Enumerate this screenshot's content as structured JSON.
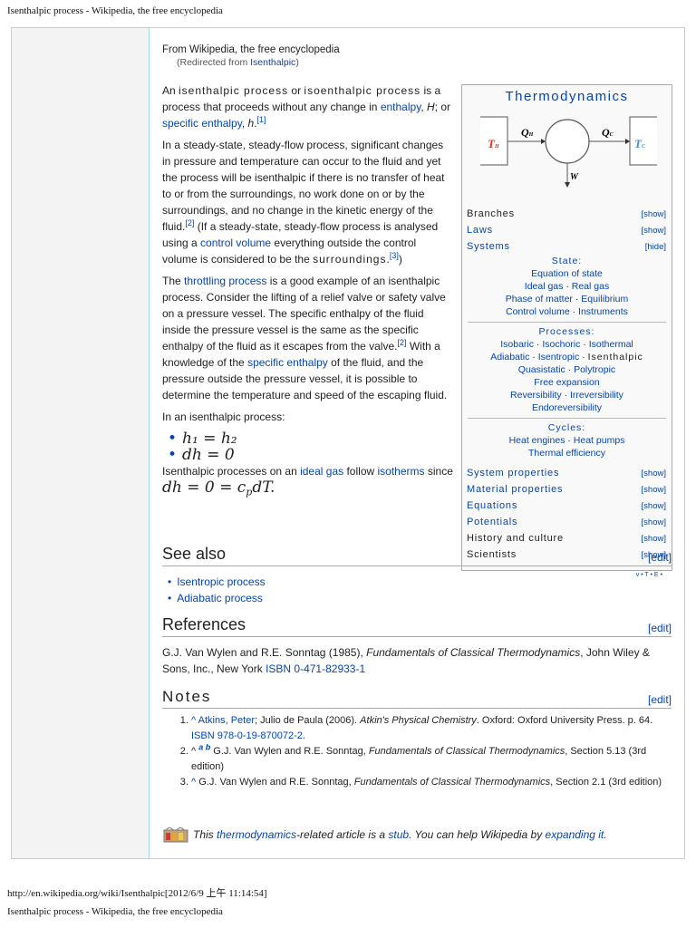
{
  "print_header": "Isenthalpic process - Wikipedia, the free encyclopedia",
  "print_footer_url": "http://en.wikipedia.org/wiki/Isenthalpic[2012/6/9 上午 11:14:54]",
  "print_footer_title": "Isenthalpic process - Wikipedia, the free encyclopedia",
  "from": "From Wikipedia, the free encyclopedia",
  "redirect": {
    "prefix": "(Redirected from ",
    "link": "Isenthalpic",
    "suffix": ")"
  },
  "paragraphs": [
    [
      [
        "t",
        "An "
      ],
      [
        "sp",
        "isenthalpic process"
      ],
      [
        "t",
        " or "
      ],
      [
        "sp",
        "isoenthalpic process"
      ],
      [
        "t",
        " is a process that proceeds without any change in "
      ],
      [
        "l",
        "enthalpy"
      ],
      [
        "t",
        ", "
      ],
      [
        "i",
        "H"
      ],
      [
        "t",
        "; or "
      ],
      [
        "l",
        "specific enthalpy"
      ],
      [
        "t",
        ", "
      ],
      [
        "i",
        "h"
      ],
      [
        "t",
        "."
      ],
      [
        "s",
        "[1]"
      ]
    ],
    [
      [
        "t",
        "In a steady-state, steady-flow process, significant changes in pressure and temperature can occur to the fluid and yet the process will be isenthalpic if there is no transfer of heat to or from the surroundings, no work done on or by the surroundings, and no change in the kinetic energy of the fluid."
      ],
      [
        "s",
        "[2]"
      ],
      [
        "t",
        " (If a steady-state, steady-flow process is analysed using a "
      ],
      [
        "l",
        "control volume"
      ],
      [
        "t",
        " everything outside the control volume is considered to be the "
      ],
      [
        "sp",
        "surroundings"
      ],
      [
        "t",
        "."
      ],
      [
        "s",
        "[3]"
      ],
      [
        "t",
        ")"
      ]
    ],
    [
      [
        "t",
        "The "
      ],
      [
        "l",
        "throttling process"
      ],
      [
        "t",
        " is a good example of an isenthalpic process. Consider the lifting of a relief valve or safety valve on a pressure vessel. The specific enthalpy of the fluid inside the pressure vessel is the same as the specific enthalpy of the fluid as it escapes from the valve."
      ],
      [
        "s",
        "[2]"
      ],
      [
        "t",
        " With a knowledge of the "
      ],
      [
        "l",
        "specific enthalpy"
      ],
      [
        "t",
        " of the fluid, and the pressure outside the pressure vessel, it is possible to determine the temperature and speed of the escaping fluid."
      ]
    ],
    [
      [
        "t",
        "In an isenthalpic process:"
      ]
    ]
  ],
  "equations": [
    "h₁ = h₂",
    "dh = 0"
  ],
  "after_eq": [
    [
      "t",
      "Isenthalpic processes on an "
    ],
    [
      "l",
      "ideal gas"
    ],
    [
      "t",
      " follow "
    ],
    [
      "l",
      "isotherms"
    ],
    [
      "t",
      " since "
    ],
    [
      "m",
      "dh = 0 = c"
    ],
    [
      "ms",
      "p"
    ],
    [
      "m",
      "dT."
    ]
  ],
  "infobox": {
    "title": "Thermodynamics",
    "diagram": {
      "hot": "T",
      "hot_sub": "H",
      "cold": "T",
      "cold_sub": "C",
      "qh": "Q",
      "qh_sub": "H",
      "qc": "Q",
      "qc_sub": "C",
      "w": "W",
      "hot_color": "#e0301e",
      "cold_color": "#3c8ee0"
    },
    "rows_top": [
      {
        "label": "Branches",
        "link": false,
        "toggle": "[show]"
      },
      {
        "label": "Laws",
        "link": true,
        "toggle": "[show]"
      },
      {
        "label": "Systems",
        "link": true,
        "toggle": "[hide]"
      }
    ],
    "groups": [
      {
        "heading": "State:",
        "lines": [
          [
            "Equation of state"
          ],
          [
            "Ideal gas",
            "Real gas"
          ],
          [
            "Phase of matter",
            "Equilibrium"
          ],
          [
            "Control volume",
            "Instruments"
          ]
        ]
      },
      {
        "heading": "Processes:",
        "lines": [
          [
            "Isobaric",
            "Isochoric",
            "Isothermal"
          ],
          [
            "Adiabatic",
            "Isentropic",
            "*Isenthalpic"
          ],
          [
            "Quasistatic",
            "Polytropic"
          ],
          [
            "Free expansion"
          ],
          [
            "Reversibility",
            "Irreversibility"
          ],
          [
            "Endoreversibility"
          ]
        ]
      },
      {
        "heading": "Cycles:",
        "lines": [
          [
            "Heat engines",
            "Heat pumps"
          ],
          [
            "Thermal efficiency"
          ]
        ]
      }
    ],
    "rows_bottom": [
      {
        "label": "System properties",
        "link": true,
        "toggle": "[show]"
      },
      {
        "label": "Material properties",
        "link": true,
        "toggle": "[show]"
      },
      {
        "label": "Equations",
        "link": true,
        "toggle": "[show]"
      },
      {
        "label": "Potentials",
        "link": true,
        "toggle": "[show]"
      },
      {
        "label": "History and culture",
        "link": false,
        "toggle": "[show]"
      },
      {
        "label": "Scientists",
        "link": false,
        "toggle": "[show]"
      }
    ],
    "vte": "v • T • E •"
  },
  "see_also": {
    "title": "See also",
    "edit": "[edit]",
    "items": [
      "Isentropic process",
      "Adiabatic process"
    ]
  },
  "references": {
    "title": "References",
    "edit": "[edit]",
    "text": [
      [
        "t",
        "G.J. Van Wylen and R.E. Sonntag (1985), "
      ],
      [
        "i",
        "Fundamentals of Classical Thermodynamics"
      ],
      [
        "t",
        ", John Wiley & Sons, Inc., New York "
      ],
      [
        "l",
        "ISBN 0-471-82933-1"
      ]
    ]
  },
  "notes": {
    "title": "Notes",
    "edit": "[edit]",
    "items": [
      [
        [
          "l",
          "^ "
        ],
        [
          "l",
          "Atkins, Peter"
        ],
        [
          "t",
          "; Julio de Paula (2006). "
        ],
        [
          "i",
          "Atkin's Physical Chemistry"
        ],
        [
          "t",
          ". Oxford: Oxford University Press. p. 64. "
        ],
        [
          "l",
          "ISBN 978-0-19-870072-2"
        ],
        [
          "t",
          "."
        ]
      ],
      [
        [
          "t",
          "^ "
        ],
        [
          "bs",
          "a b"
        ],
        [
          "t",
          " G.J. Van Wylen and R.E. Sonntag, "
        ],
        [
          "i",
          "Fundamentals of Classical Thermodynamics"
        ],
        [
          "t",
          ", Section 5.13 (3rd edition)"
        ]
      ],
      [
        [
          "l",
          "^ "
        ],
        [
          "t",
          " G.J. Van Wylen and R.E. Sonntag, "
        ],
        [
          "i",
          "Fundamentals of Classical Thermodynamics"
        ],
        [
          "t",
          ", Section 2.1 (3rd edition)"
        ]
      ]
    ]
  },
  "stub": [
    [
      "t",
      "This "
    ],
    [
      "l",
      "thermodynamics"
    ],
    [
      "t",
      "-related article is a "
    ],
    [
      "l",
      "stub"
    ],
    [
      "t",
      ". You can help Wikipedia by "
    ],
    [
      "l",
      "expanding it"
    ],
    [
      "t",
      "."
    ]
  ]
}
